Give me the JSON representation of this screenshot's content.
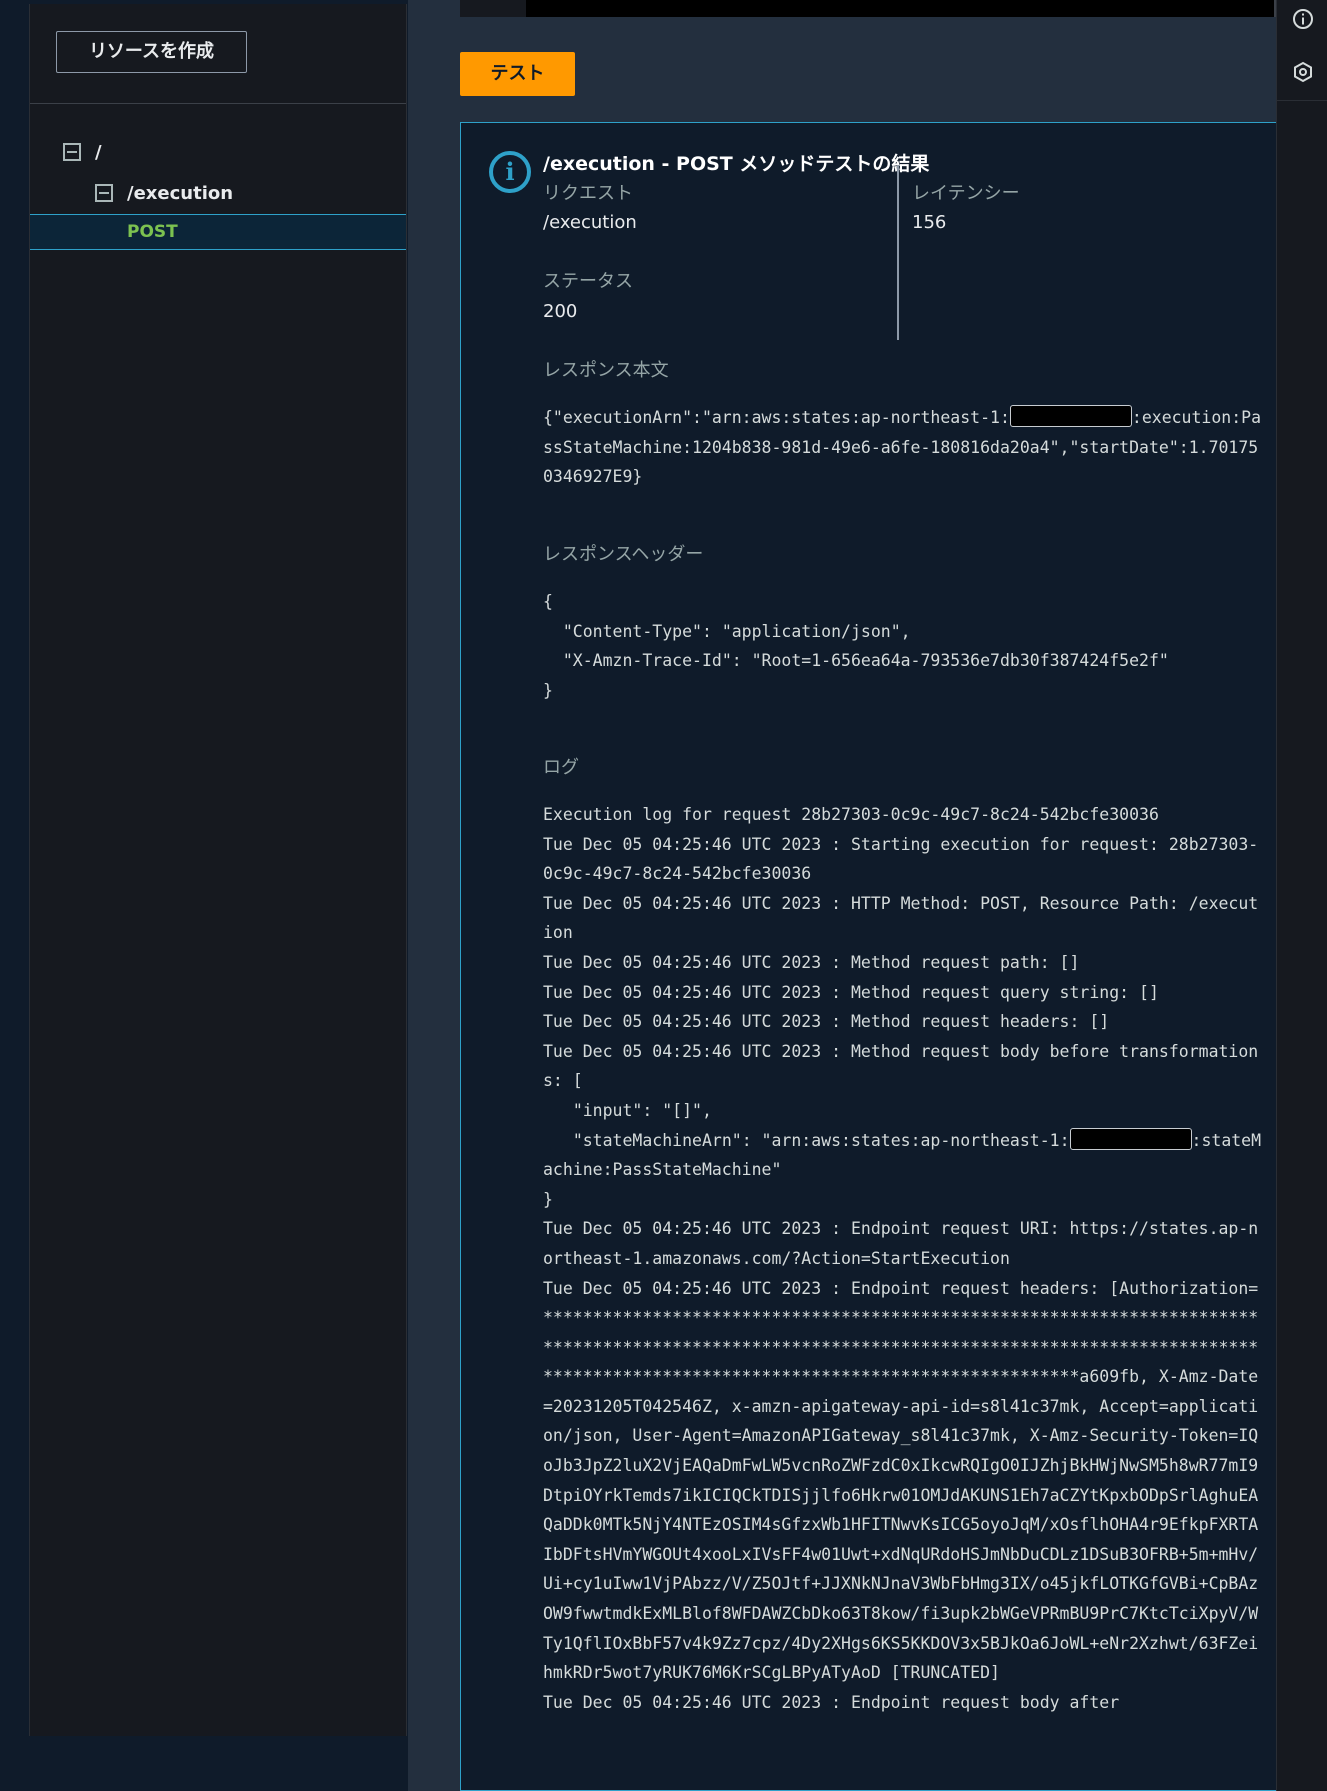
{
  "sidebar": {
    "create_resource_label": "リソースを作成",
    "tree": {
      "root_label": "/",
      "execution_label": "/execution",
      "post_label": "POST"
    }
  },
  "main": {
    "test_button_label": "テスト",
    "result": {
      "title": "/execution - POST メソッドテストの結果",
      "request_label": "リクエスト",
      "request_value": "/execution",
      "latency_label": "レイテンシー",
      "latency_value": "156",
      "status_label": "ステータス",
      "status_value": "200",
      "response_body_label": "レスポンス本文",
      "response_body": {
        "part1": "{\"executionArn\":\"arn:aws:states:ap-northeast-1:",
        "part2": ":execution:PassStateMachine:1204b838-981d-49e6-a6fe-180816da20a4\",\"startDate\":1.701750346927E9}"
      },
      "response_headers_label": "レスポンスヘッダー",
      "response_headers": "{\n  \"Content-Type\": \"application/json\",\n  \"X-Amzn-Trace-Id\": \"Root=1-656ea64a-793536e7db30f387424f5e2f\"\n}",
      "logs_label": "ログ",
      "logs": {
        "part1": "Execution log for request 28b27303-0c9c-49c7-8c24-542bcfe30036\nTue Dec 05 04:25:46 UTC 2023 : Starting execution for request: 28b27303-0c9c-49c7-8c24-542bcfe30036\nTue Dec 05 04:25:46 UTC 2023 : HTTP Method: POST, Resource Path: /execution\nTue Dec 05 04:25:46 UTC 2023 : Method request path: []\nTue Dec 05 04:25:46 UTC 2023 : Method request query string: []\nTue Dec 05 04:25:46 UTC 2023 : Method request headers: []\nTue Dec 05 04:25:46 UTC 2023 : Method request body before transformations: [\n   \"input\": \"[]\",\n   \"stateMachineArn\": \"arn:aws:states:ap-northeast-1:",
        "part2": ":stateMachine:PassStateMachine\"\n}\nTue Dec 05 04:25:46 UTC 2023 : Endpoint request URI: https://states.ap-northeast-1.amazonaws.com/?Action=StartExecution\nTue Dec 05 04:25:46 UTC 2023 : Endpoint request headers: [Authorization=******************************************************************************************************************************************************************************************************a609fb, X-Amz-Date=20231205T042546Z, x-amzn-apigateway-api-id=s8l41c37mk, Accept=application/json, User-Agent=AmazonAPIGateway_s8l41c37mk, X-Amz-Security-Token=IQoJb3JpZ2luX2VjEAQaDmFwLW5vcnRoZWFzdC0xIkcwRQIgO0IJZhjBkHWjNwSM5h8wR77mI9DtpiOYrkTemds7ikICIQCkTDISjjlfo6Hkrw01OMJdAKUNS1Eh7aCZYtKpxbODpSrlAghuEAQaDDk0MTk5NjY4NTEzOSIM4sGfzxWb1HFITNwvKsICG5oyoJqM/xOsflhOHA4r9EfkpFXRTAIbDFtsHVmYWGOUt4xooLxIVsFF4w01Uwt+xdNqURdoHSJmNbDuCDLz1DSuB3OFRB+5m+mHv/Ui+cy1uIww1VjPAbzz/V/Z5OJtf+JJXNkNJnaV3WbFbHmg3IX/o45jkfLOTKGfGVBi+CpBAzOW9fwwtmdkExMLBlof8WFDAWZCbDko63T8kow/fi3upk2bWGeVPRmBU9PrC7KtcTciXpyV/WTy1QflIOxBbF57v4k9Zz7cpz/4Dy2XHgs6KS5KKDOV3x5BJkOa6JoWL+eNr2Xzhwt/63FZeihmkRDr5wot7yRUK76M6KrSCgLBPyATyAoD [TRUNCATED]\nTue Dec 05 04:25:46 UTC 2023 : Endpoint request body after"
      }
    }
  },
  "colors": {
    "accent": "#ff9900",
    "info": "#2ea1c9",
    "selected_method": "#7cc250"
  },
  "icons": [
    "collapse-icon",
    "info-icon",
    "info-circle-icon",
    "settings-hex-icon"
  ]
}
